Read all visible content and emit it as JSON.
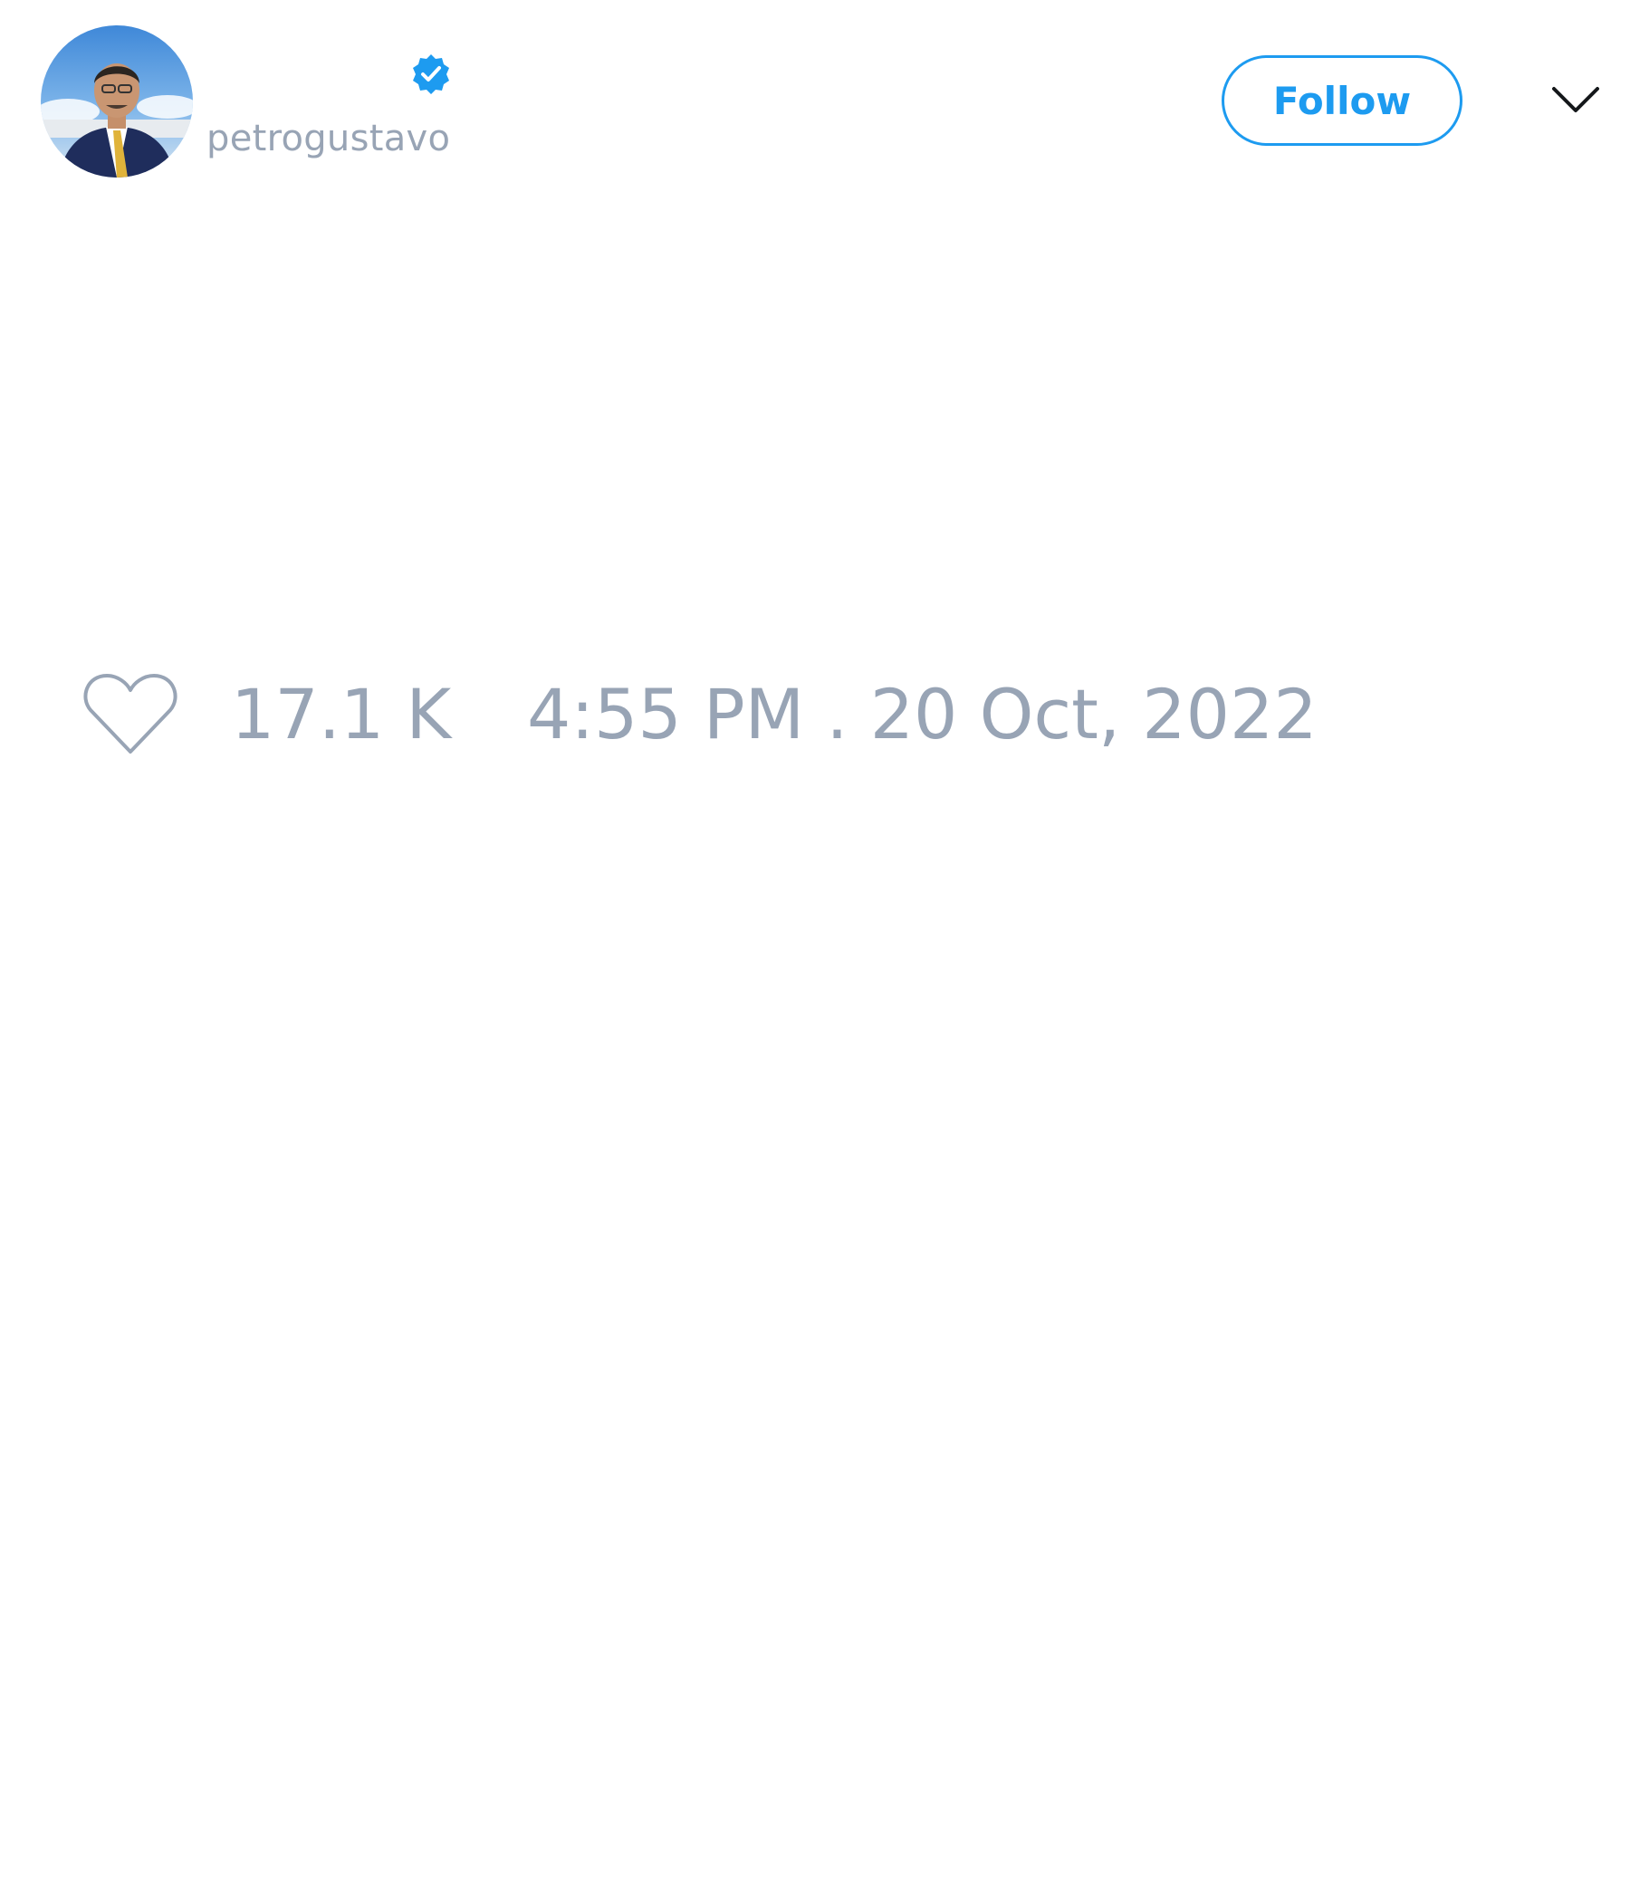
{
  "user": {
    "display_name": "",
    "handle": "petrogustavo",
    "verified": true,
    "avatar_icon": "profile-photo"
  },
  "actions": {
    "follow_label": "Follow",
    "more_icon": "chevron-down-icon"
  },
  "tweet": {
    "text": "",
    "like_icon": "heart-outline-icon",
    "like_count": "17.1 K",
    "timestamp": "4:55 PM . 20 Oct, 2022"
  },
  "colors": {
    "accent": "#1d9bf0",
    "muted_text": "#98a4b5",
    "background": "#ffffff"
  }
}
